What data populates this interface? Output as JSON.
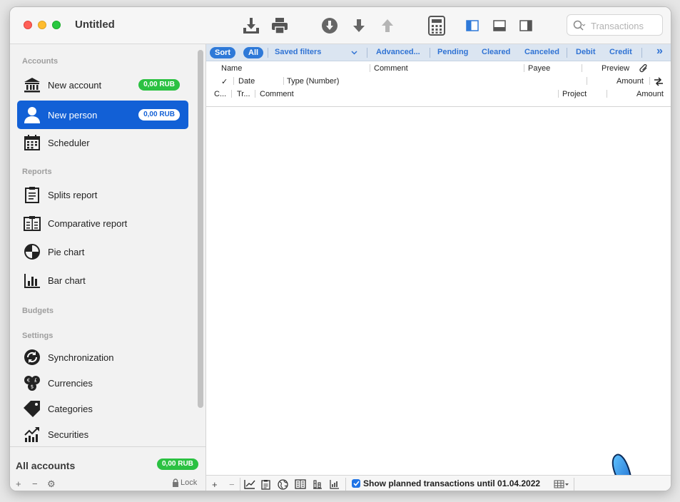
{
  "window": {
    "title": "Untitled"
  },
  "toolbar": {
    "icons": [
      "import-icon",
      "print-icon",
      "download-circle-icon",
      "arrow-down-icon",
      "arrow-up-icon",
      "calculator-icon",
      "layout-sidebar-icon",
      "layout-bottom-icon",
      "layout-right-icon"
    ],
    "search_placeholder": "Transactions"
  },
  "sidebar": {
    "sections": {
      "accounts": "Accounts",
      "reports": "Reports",
      "budgets": "Budgets",
      "settings": "Settings"
    },
    "accounts": [
      {
        "label": "New account",
        "badge": "0,00 RUB",
        "icon": "bank-icon"
      },
      {
        "label": "New person",
        "badge": "0,00 RUB",
        "icon": "person-icon",
        "active": true
      },
      {
        "label": "Scheduler",
        "icon": "calendar-icon"
      }
    ],
    "reports": [
      {
        "label": "Splits report",
        "icon": "clipboard-icon"
      },
      {
        "label": "Comparative report",
        "icon": "comparative-report-icon"
      },
      {
        "label": "Pie chart",
        "icon": "pie-chart-icon"
      },
      {
        "label": "Bar chart",
        "icon": "bar-chart-icon"
      }
    ],
    "settings": [
      {
        "label": "Synchronization",
        "icon": "sync-icon"
      },
      {
        "label": "Currencies",
        "icon": "currencies-icon"
      },
      {
        "label": "Categories",
        "icon": "tag-icon"
      },
      {
        "label": "Securities",
        "icon": "securities-icon"
      }
    ],
    "all_accounts": {
      "label": "All accounts",
      "badge": "0,00 RUB"
    },
    "bottom": {
      "add": "+",
      "remove": "−",
      "gear": "⚙",
      "lock": "Lock"
    }
  },
  "filters": {
    "sort": "Sort",
    "all": "All",
    "saved_filters": "Saved filters",
    "advanced": "Advanced...",
    "pending": "Pending",
    "cleared": "Cleared",
    "canceled": "Canceled",
    "debit": "Debit",
    "credit": "Credit",
    "more": "»"
  },
  "columns": {
    "row1": {
      "name": "Name",
      "comment": "Comment",
      "payee": "Payee",
      "preview": "Preview"
    },
    "row2": {
      "check": "✓",
      "date": "Date",
      "type": "Type (Number)",
      "amount": "Amount"
    },
    "row3": {
      "c": "C...",
      "tr": "Tr...",
      "comment": "Comment",
      "project": "Project",
      "amount": "Amount"
    }
  },
  "bottom_bar": {
    "add": "+",
    "remove": "−",
    "planned_label": "Show planned transactions until 01.04.2022",
    "planned_checked": true
  },
  "colors": {
    "accent": "#1260d6",
    "badge": "#2bc142",
    "filter_text": "#3073d4",
    "butterfly": "#2b8be8"
  }
}
